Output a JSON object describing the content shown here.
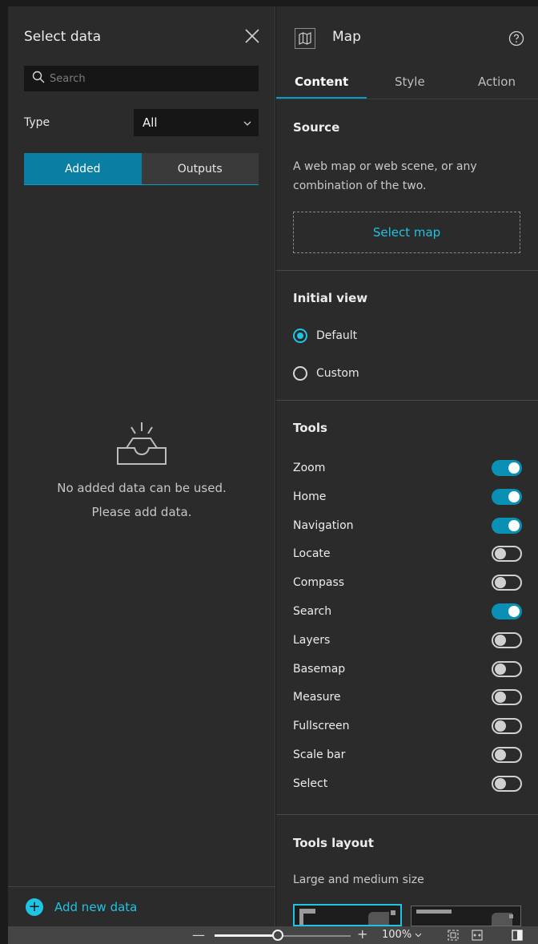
{
  "select_data": {
    "title": "Select data",
    "search_placeholder": "Search",
    "type_label": "Type",
    "type_value": "All",
    "tabs": [
      "Added",
      "Outputs"
    ],
    "empty_message_line1": "No added data can be used.",
    "empty_message_line2": "Please add data.",
    "add_new_label": "Add new data"
  },
  "map_panel": {
    "title": "Map",
    "tabs": [
      "Content",
      "Style",
      "Action"
    ],
    "source": {
      "title": "Source",
      "description": "A web map or web scene, or any combination of the two.",
      "select_button": "Select map"
    },
    "initial_view": {
      "title": "Initial view",
      "options": [
        {
          "label": "Default",
          "checked": true
        },
        {
          "label": "Custom",
          "checked": false
        }
      ]
    },
    "tools": {
      "title": "Tools",
      "items": [
        {
          "label": "Zoom",
          "on": true
        },
        {
          "label": "Home",
          "on": true
        },
        {
          "label": "Navigation",
          "on": true
        },
        {
          "label": "Locate",
          "on": false
        },
        {
          "label": "Compass",
          "on": false
        },
        {
          "label": "Search",
          "on": true
        },
        {
          "label": "Layers",
          "on": false
        },
        {
          "label": "Basemap",
          "on": false
        },
        {
          "label": "Measure",
          "on": false
        },
        {
          "label": "Fullscreen",
          "on": false
        },
        {
          "label": "Scale bar",
          "on": false
        },
        {
          "label": "Select",
          "on": false
        }
      ]
    },
    "tools_layout": {
      "title": "Tools layout",
      "subtitle": "Large and medium size"
    }
  },
  "status_bar": {
    "zoom_value": "100%",
    "zoom_fraction": 0.47
  },
  "colors": {
    "accent": "#1fc3e3",
    "active_tab": "#0a7fa3",
    "toggle_on": "#0a8fb5",
    "panel_bg": "#2b2b2b"
  }
}
